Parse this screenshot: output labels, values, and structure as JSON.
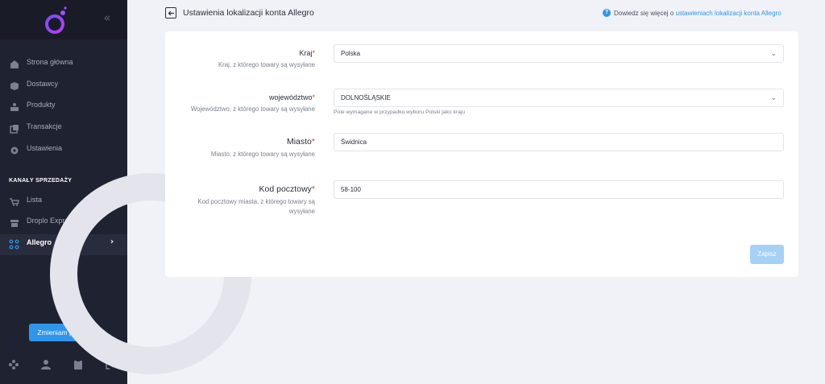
{
  "sidebar": {
    "items": [
      {
        "label": "Strona główna",
        "icon": "home-icon"
      },
      {
        "label": "Dostawcy",
        "icon": "box-icon"
      },
      {
        "label": "Produkty",
        "icon": "product-icon"
      },
      {
        "label": "Transakcje",
        "icon": "transactions-icon"
      },
      {
        "label": "Ustawienia",
        "icon": "gear-icon"
      }
    ],
    "section_title": "KANAŁY SPRZEDAŻY",
    "channels": [
      {
        "label": "Lista",
        "icon": "cart-icon"
      },
      {
        "label": "Droplo Express",
        "icon": "store-icon"
      },
      {
        "label": "Allegro",
        "icon": "allegro-icon",
        "active": true
      }
    ],
    "package_button": "Zmieniam pakiet"
  },
  "header": {
    "title": "Ustawienia lokalizacji konta Allegro",
    "help_prefix": "Dowiedz się więcej o",
    "help_link": "ustawieniach lokalizacji konta Allegro"
  },
  "form": {
    "country": {
      "label": "Kraj",
      "required": "*",
      "description": "Kraj, z którego towary są wysyłane",
      "value": "Polska"
    },
    "province": {
      "label": "województwo",
      "required": "*",
      "description": "Województwo, z którego towary są wysyłane",
      "value": "DOLNOŚLĄSKIE",
      "hint": "Pole wymagane w przypadku wyboru Polski jako kraju"
    },
    "city": {
      "label": "Miasto",
      "required": "*",
      "description": "Miasto, z którego towary są wysyłane",
      "value": "Świdnica"
    },
    "postal": {
      "label": "Kod pocztowy",
      "required": "*",
      "description_line1": "Kod pocztowy miasta, z którego towary są",
      "description_line2": "wysyłane",
      "value": "58-100"
    },
    "save_label": "Zapisz"
  },
  "colors": {
    "accent": "#2f96ec",
    "sidebar_bg": "#1f2230",
    "required": "#e53935"
  }
}
